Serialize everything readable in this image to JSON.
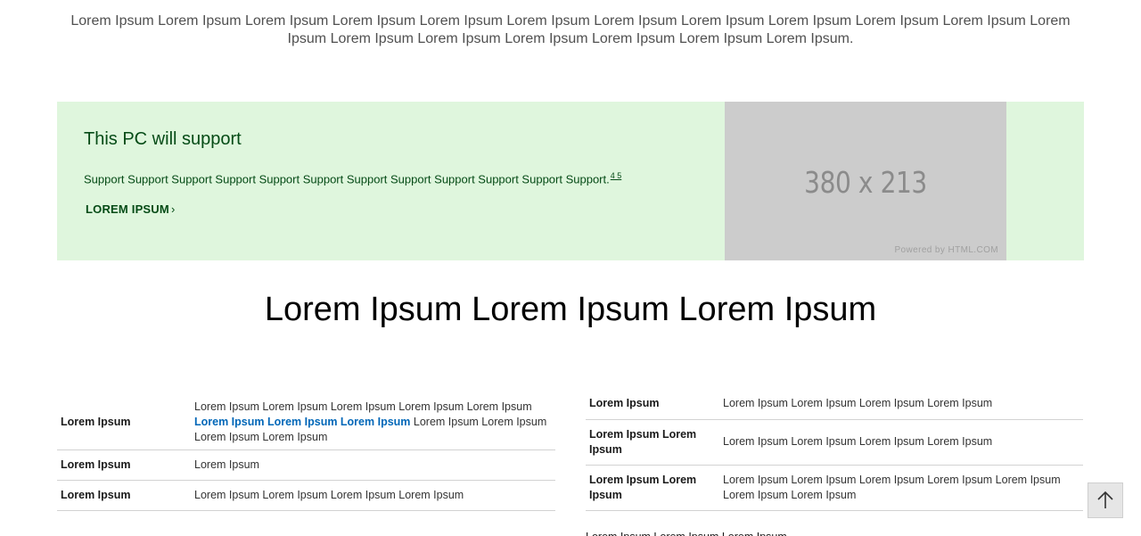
{
  "intro": {
    "text": "Lorem Ipsum Lorem Ipsum Lorem Ipsum Lorem Ipsum Lorem Ipsum Lorem Ipsum Lorem Ipsum Lorem Ipsum Lorem Ipsum Lorem Ipsum Lorem Ipsum Lorem Ipsum Lorem Ipsum Lorem Ipsum Lorem Ipsum Lorem Ipsum Lorem Ipsum Lorem Ipsum."
  },
  "banner": {
    "title": "This PC will support",
    "text": "Support Support Support Support Support Support Support Support Support Support Support Support.",
    "footnotes": "4 5",
    "link_label": "LOREM IPSUM",
    "link_chevron": "›",
    "placeholder_size": "380 x 213",
    "placeholder_credit": "Powered by HTML.COM"
  },
  "section": {
    "heading": "Lorem Ipsum Lorem Ipsum Lorem Ipsum"
  },
  "left_table": {
    "rows": [
      {
        "key": "Lorem Ipsum",
        "value_before": "Lorem Ipsum Lorem Ipsum Lorem Ipsum Lorem Ipsum Lorem Ipsum",
        "value_link": "Lorem Ipsum Lorem Ipsum Lorem Ipsum",
        "value_after": "Lorem Ipsum Lorem Ipsum Lorem Ipsum Lorem Ipsum"
      },
      {
        "key": "Lorem Ipsum",
        "value": "Lorem Ipsum"
      },
      {
        "key": "Lorem Ipsum",
        "value": "Lorem Ipsum Lorem Ipsum Lorem Ipsum Lorem Ipsum"
      }
    ]
  },
  "right_table": {
    "rows": [
      {
        "key": "Lorem Ipsum",
        "value": "Lorem Ipsum Lorem Ipsum Lorem Ipsum Lorem Ipsum"
      },
      {
        "key": "Lorem Ipsum Lorem Ipsum",
        "value": "Lorem Ipsum Lorem Ipsum Lorem Ipsum Lorem Ipsum"
      },
      {
        "key": "Lorem Ipsum Lorem Ipsum",
        "value": "Lorem Ipsum Lorem Ipsum Lorem Ipsum Lorem Ipsum Lorem Ipsum Lorem Ipsum Lorem Ipsum"
      }
    ],
    "partial_row": "Lorem Ipsum Lorem Ipsum Lorem Ipsum"
  },
  "back_to_top": {
    "icon": "arrow-up-icon"
  },
  "colors": {
    "banner_bg": "#dff6dd",
    "banner_text": "#054b16",
    "link_blue": "#0067b8",
    "placeholder_bg": "#cccccc"
  }
}
